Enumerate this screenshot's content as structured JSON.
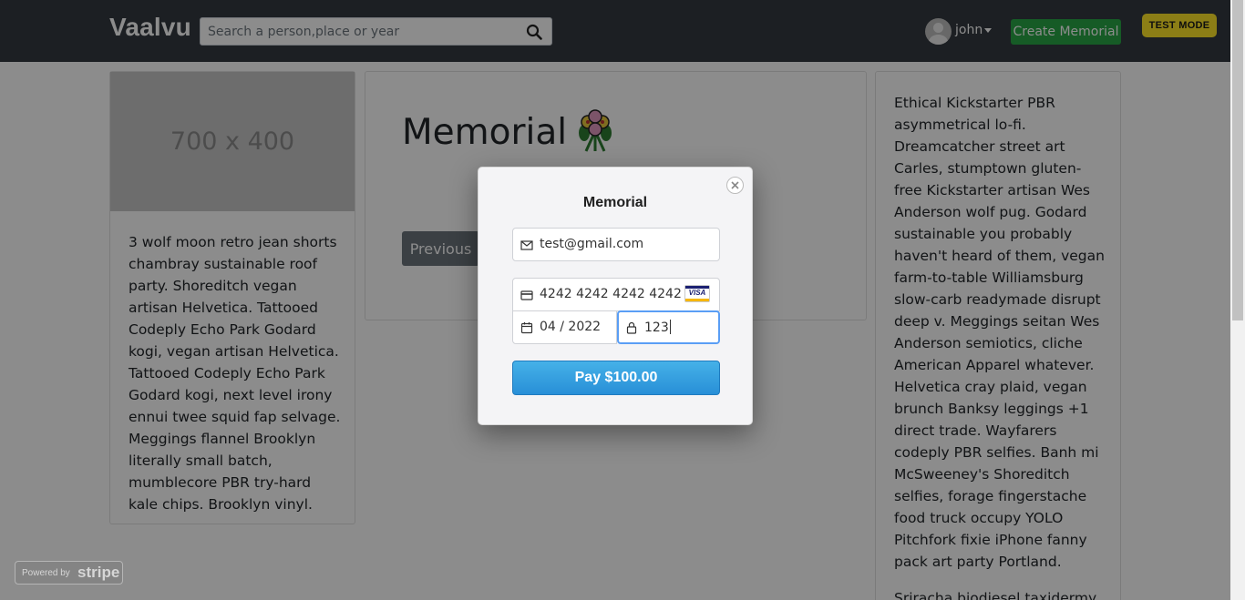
{
  "navbar": {
    "brand": "Vaalvu",
    "search_placeholder": "Search a person,place or year",
    "user_name": "john",
    "create_button": "Create Memorial",
    "test_mode": "TEST MODE"
  },
  "left_card": {
    "image_placeholder": "700 x 400",
    "text": "3 wolf moon retro jean shorts chambray sustainable roof party. Shoreditch vegan artisan Helvetica. Tattooed Codeply Echo Park Godard kogi, vegan artisan Helvetica. Tattooed Codeply Echo Park Godard kogi, next level irony ennui twee squid fap selvage. Meggings flannel Brooklyn literally small batch, mumblecore PBR try-hard kale chips. Brooklyn vinyl."
  },
  "middle_card": {
    "title": "Memorial",
    "previous_button": "Previous"
  },
  "right_card": {
    "text": "Ethical Kickstarter PBR asymmetrical lo-fi. Dreamcatcher street art Carles, stumptown gluten-free Kickstarter artisan Wes Anderson wolf pug. Godard sustainable you probably haven't heard of them, vegan farm-to-table Williamsburg slow-carb readymade disrupt deep v. Meggings seitan Wes Anderson semiotics, cliche American Apparel whatever. Helvetica cray plaid, vegan brunch Banksy leggings +1 direct trade. Wayfarers codeply PBR selfies. Banh mi McSweeney's Shoreditch selfies, forage fingerstache food truck occupy YOLO Pitchfork fixie iPhone fanny pack art party Portland.",
    "text2": "Sriracha biodiesel taxidermy"
  },
  "checkout": {
    "title": "Memorial",
    "email": "test@gmail.com",
    "card_number": "4242 4242 4242 4242",
    "card_brand": "VISA",
    "expiry": "04 / 2022",
    "cvc": "123",
    "pay_button": "Pay $100.00"
  },
  "powered_by": {
    "prefix": "Powered by",
    "brand": "stripe"
  }
}
